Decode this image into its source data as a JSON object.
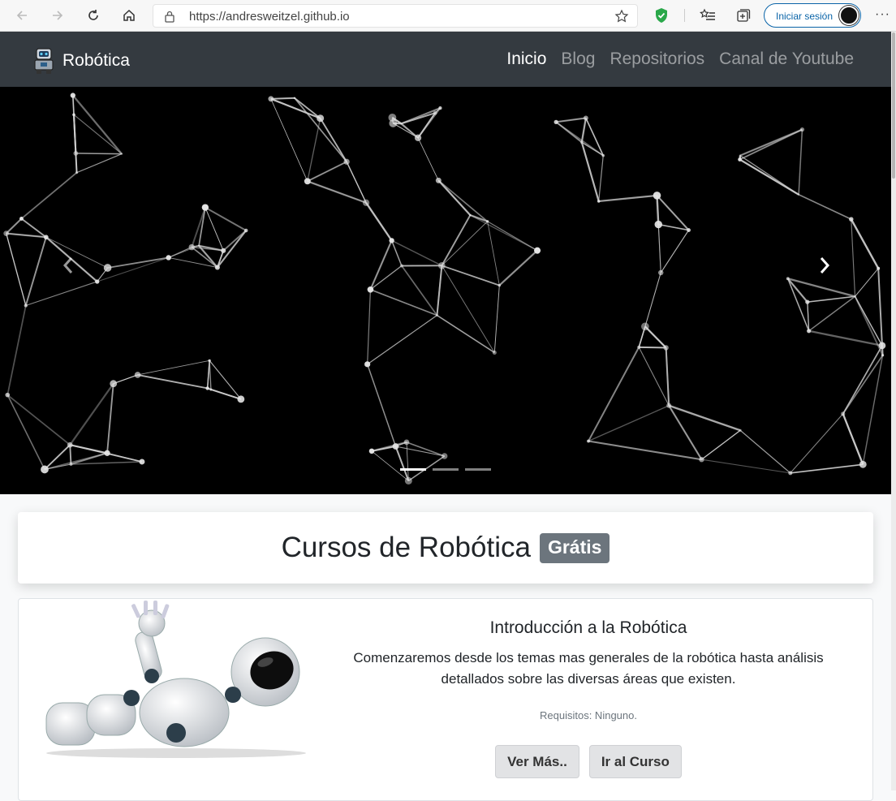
{
  "browser": {
    "url": "https://andresweitzel.github.io",
    "signin_label": "Iniciar sesión",
    "more_label": "···"
  },
  "navbar": {
    "brand": "Robótica",
    "links": [
      {
        "label": "Inicio",
        "active": true
      },
      {
        "label": "Blog",
        "active": false
      },
      {
        "label": "Repositorios",
        "active": false
      },
      {
        "label": "Canal de Youtube",
        "active": false
      }
    ]
  },
  "carousel": {
    "slide_count": 3,
    "active_index": 0
  },
  "heading": {
    "title": "Cursos de Robótica",
    "badge": "Grátis"
  },
  "course": {
    "title": "Introducción a la Robótica",
    "description": "Comenzaremos desde los temas mas generales de la robótica hasta análisis detallados sobre las diversas áreas que existen.",
    "requirements": "Requisitos: Ninguno.",
    "buttons": {
      "more": "Ver Más..",
      "go": "Ir al Curso"
    }
  },
  "colors": {
    "navbar_bg": "#343a40",
    "badge_bg": "#6c757d",
    "signin_accent": "#0a64a8",
    "shield_green": "#2aa84a"
  }
}
